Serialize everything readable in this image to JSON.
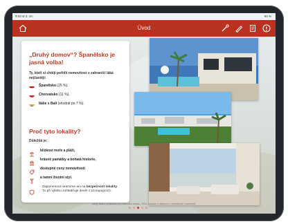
{
  "status_bar": {
    "time": "9:03 st 3. 10.",
    "battery": "94 %"
  },
  "app_bar": {
    "title": "Úvod",
    "accent": "#b8321f"
  },
  "card": {
    "headline": "„Druhý domov“? Španělsko je jasná volba!",
    "intro": "Ty, kteří si chtějí pořídit nemovitost v zahraničí láká nejčastěji:",
    "countries": [
      {
        "name": "Španělsko",
        "detail": " (25 %),"
      },
      {
        "name": "Chorvatsko",
        "detail": " (11 %),"
      },
      {
        "name": "Itálie s Bali",
        "detail": " (shodně po 7 %)."
      }
    ],
    "reasons_title": "Proč tyto lokality?",
    "reasons_sub": "Důležitá je:",
    "reasons": [
      "blízkost moře a pláží,",
      "krásné památky a bohatá historie,",
      "dostupné ceny nemovitostí",
      "a tamní životní styl."
    ],
    "note_pre": "Zapomenout nesmíme ani na ",
    "note_bold": "bezpečnost lokality",
    "note_post": ". Tu při výběru zohledňuje devět z 10 kupujících."
  },
  "footer": "Zdroj: data z průzkumu pro obchodní banku, 2024; kupující a zájemci o nemovitost v zahraničí.",
  "pagination": {
    "total": 5,
    "active": 3
  }
}
